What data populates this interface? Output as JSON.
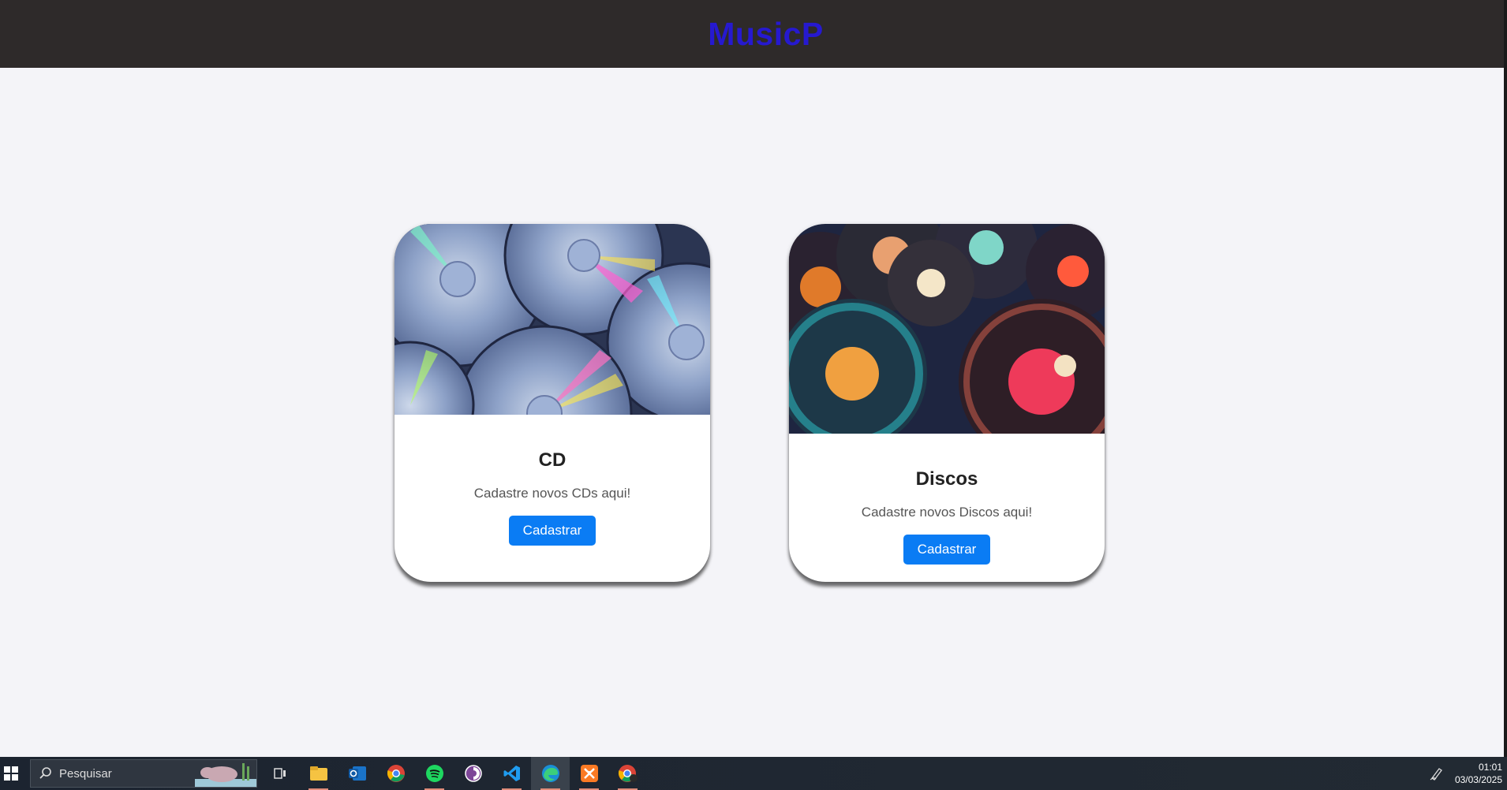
{
  "app": {
    "title": "MusicP"
  },
  "cards": [
    {
      "title": "CD",
      "description": "Cadastre novos CDs aqui!",
      "button_label": "Cadastrar"
    },
    {
      "title": "Discos",
      "description": "Cadastre novos Discos aqui!",
      "button_label": "Cadastrar"
    }
  ],
  "taskbar": {
    "search_placeholder": "Pesquisar",
    "apps": [
      "windows-start-icon",
      "task-view-icon",
      "file-explorer-icon",
      "outlook-icon",
      "chrome-icon",
      "spotify-icon",
      "tor-browser-icon",
      "vscode-icon",
      "edge-icon",
      "xampp-icon",
      "chrome-profile-icon"
    ],
    "time": "01:01",
    "date": "03/03/2025"
  },
  "colors": {
    "header_bg": "#2e2a2a",
    "title": "#2619d0",
    "button": "#0a7cf4",
    "page_bg": "#f4f4f8"
  }
}
